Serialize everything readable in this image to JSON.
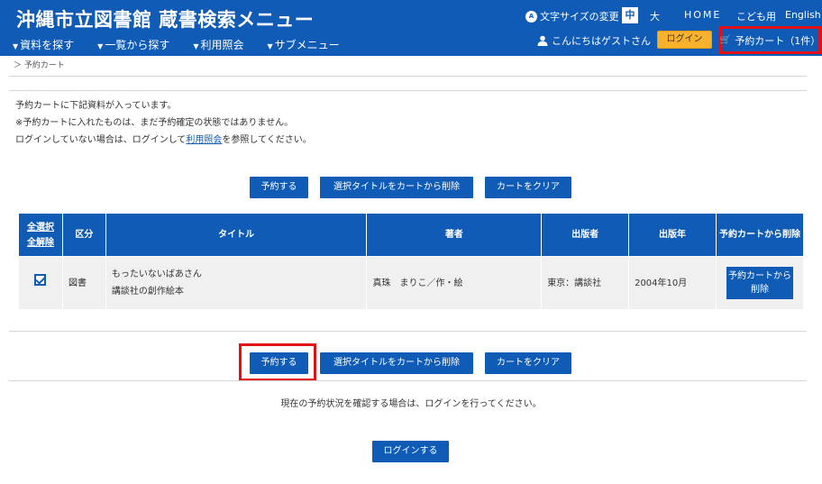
{
  "header": {
    "site_title": "沖縄市立図書館 蔵書検索メニュー",
    "nav": [
      "資料を探す",
      "一覧から探す",
      "利用照会",
      "サブメニュー"
    ],
    "font_size_label": "文字サイズの変更",
    "font_size_mid": "中",
    "font_size_large": "大",
    "home": "HOME",
    "kids": "こども用",
    "english": "English",
    "greeting": "こんにちはゲストさん",
    "login": "ログイン",
    "cart": "予約カート（1件）"
  },
  "breadcrumb": "＞ 予約カート",
  "notice": {
    "line1": "予約カートに下記資料が入っています。",
    "line2": "※予約カートに入れたものは、まだ予約確定の状態ではありません。",
    "line3_before": "ログインしていない場合は、ログインして",
    "line3_link": "利用照会",
    "line3_after": "を参照してください。"
  },
  "actions": {
    "reserve": "予約する",
    "remove_selected": "選択タイトルをカートから削除",
    "clear_cart": "カートをクリア"
  },
  "table": {
    "headers": {
      "select_all": "全選択",
      "deselect_all": "全解除",
      "category": "区分",
      "title": "タイトル",
      "author": "著者",
      "publisher": "出版者",
      "year": "出版年",
      "remove": "予約カートから削除"
    },
    "rows": [
      {
        "checked": true,
        "category": "図書",
        "title": "もったいないばあさん",
        "series": "講談社の創作絵本",
        "author": "真珠　まりこ／作・絵",
        "publisher": "東京：講談社",
        "year": "2004年10月",
        "remove_label": "予約カートから削除"
      }
    ]
  },
  "status_message": "現在の予約状況を確認する場合は、ログインを行ってください。",
  "login_button": "ログインする",
  "colors": {
    "brand_blue": "#0f5bb5",
    "login_orange": "#f7b12c",
    "highlight_red": "#e01017"
  }
}
